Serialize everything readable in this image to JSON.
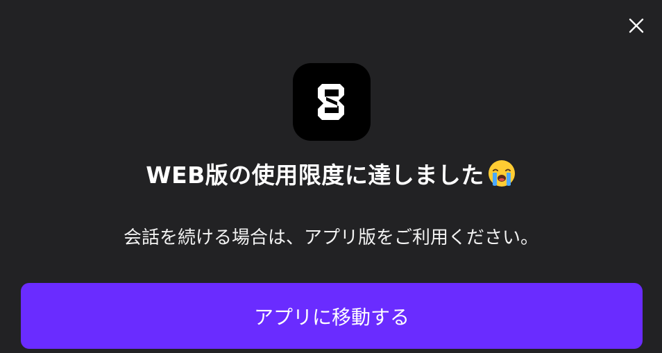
{
  "dialog": {
    "close_icon": "close-icon",
    "logo_icon": "app-logo-icon",
    "title": "WEB版の使用限度に達しました",
    "title_emoji": "loudly-crying-face-emoji",
    "message": "会話を続ける場合は、アプリ版をご利用ください。",
    "cta_label": "アプリに移動する"
  },
  "colors": {
    "background": "#222224",
    "accent": "#6a2cff",
    "logo_bg": "#000000",
    "text": "#ffffff"
  }
}
